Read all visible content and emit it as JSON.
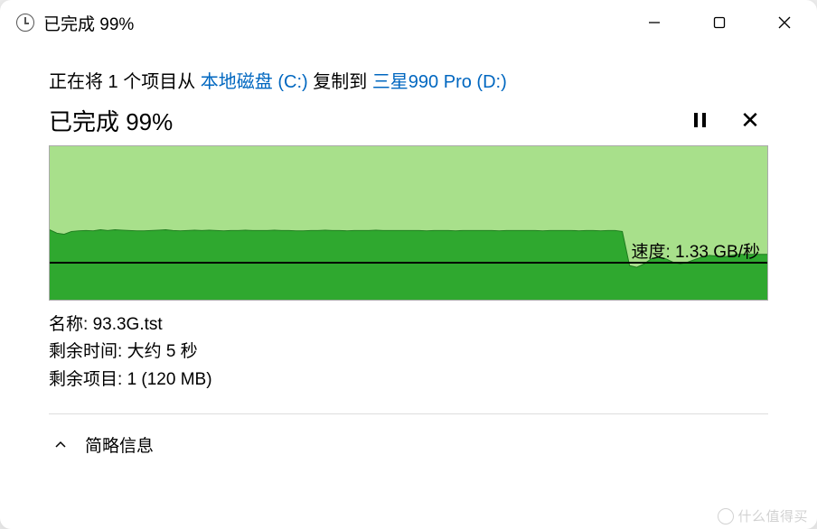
{
  "title": "已完成 99%",
  "description": {
    "prefix": "正在将 1 个项目从 ",
    "source": "本地磁盘 (C:)",
    "mid": " 复制到 ",
    "dest": "三星990 Pro (D:)"
  },
  "progress": {
    "label": "已完成 99%",
    "percent": 99
  },
  "speed": {
    "label_prefix": "速度: ",
    "value": "1.33 GB/秒"
  },
  "details": {
    "name_label": "名称: ",
    "name_value": "93.3G.tst",
    "time_label": "剩余时间: ",
    "time_value": "大约 5 秒",
    "items_label": "剩余项目: ",
    "items_value": "1 (120 MB)"
  },
  "more_label": "简略信息",
  "watermark": "什么值得买",
  "chart_data": {
    "type": "area",
    "xlabel": "",
    "ylabel": "",
    "ylim": [
      0,
      4.5
    ],
    "speed_line_value": 1.33,
    "series": [
      {
        "name": "transfer_speed_GBps",
        "values": [
          2.05,
          1.95,
          1.92,
          2.0,
          2.02,
          2.03,
          2.02,
          2.05,
          2.03,
          2.05,
          2.04,
          2.03,
          2.02,
          2.02,
          2.03,
          2.04,
          2.05,
          2.03,
          2.02,
          2.03,
          2.04,
          2.03,
          2.04,
          2.03,
          2.02,
          2.03,
          2.03,
          2.04,
          2.03,
          2.03,
          2.03,
          2.04,
          2.03,
          2.03,
          2.02,
          2.02,
          2.03,
          2.03,
          2.04,
          2.03,
          2.03,
          2.02,
          2.03,
          2.03,
          2.03,
          2.04,
          2.03,
          2.03,
          2.03,
          2.03,
          2.03,
          2.03,
          2.02,
          2.03,
          2.03,
          2.03,
          2.02,
          2.03,
          2.03,
          2.03,
          2.03,
          2.03,
          2.02,
          2.03,
          2.03,
          2.03,
          2.03,
          2.03,
          2.02,
          2.03,
          2.03,
          2.03,
          2.03,
          2.02,
          2.03,
          2.03,
          2.02,
          2.03,
          2.03,
          2.0,
          1.0,
          0.95,
          1.05,
          1.2,
          1.25,
          1.2,
          1.1,
          1.05,
          1.1,
          1.18,
          1.25,
          1.3,
          1.28,
          1.25,
          1.3,
          1.33,
          1.33,
          1.33,
          1.33,
          1.33
        ]
      }
    ]
  }
}
